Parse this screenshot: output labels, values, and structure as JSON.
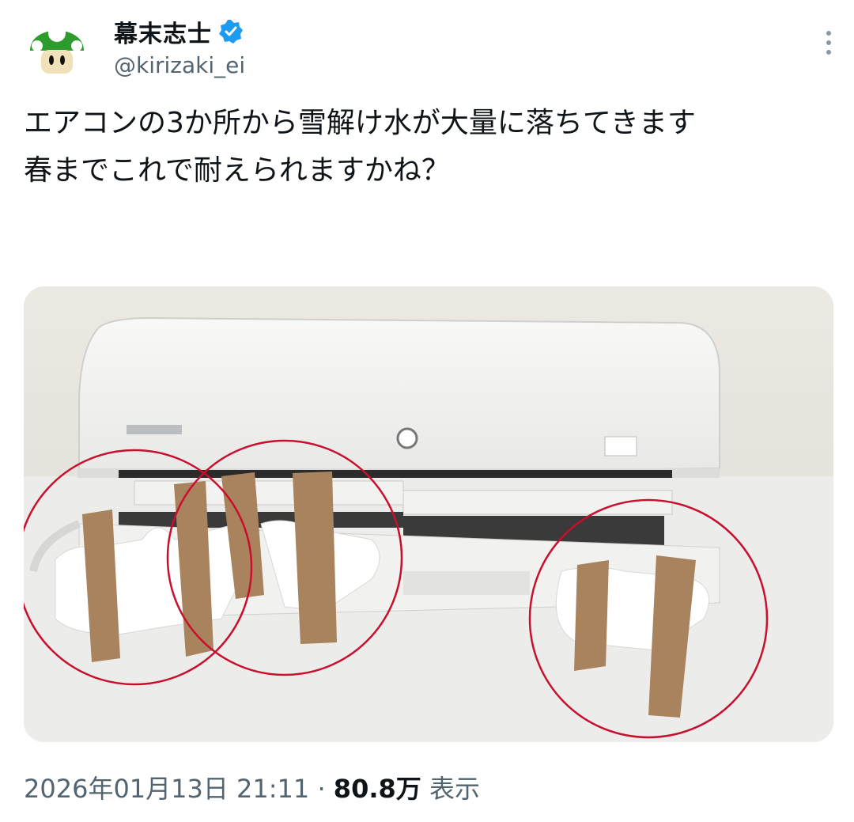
{
  "author": {
    "display_name": "幕末志士",
    "handle": "@kirizaki_ei",
    "avatar_icon": "green-mushroom-avatar",
    "verified_icon": "verified-badge-icon",
    "verified_color": "#1d9bf0"
  },
  "menu_icon": "more-vertical-icon",
  "tweet": {
    "text": "エアコンの3か所から雪解け水が大量に落ちてきます\n春までこれで耐えられますかね？"
  },
  "media": {
    "kind": "photo",
    "circle_color": "#c8102e"
  },
  "meta": {
    "timestamp": "2026年01月13日 21:11",
    "separator": " · ",
    "views_count": "80.8万",
    "views_label": " 表示"
  }
}
